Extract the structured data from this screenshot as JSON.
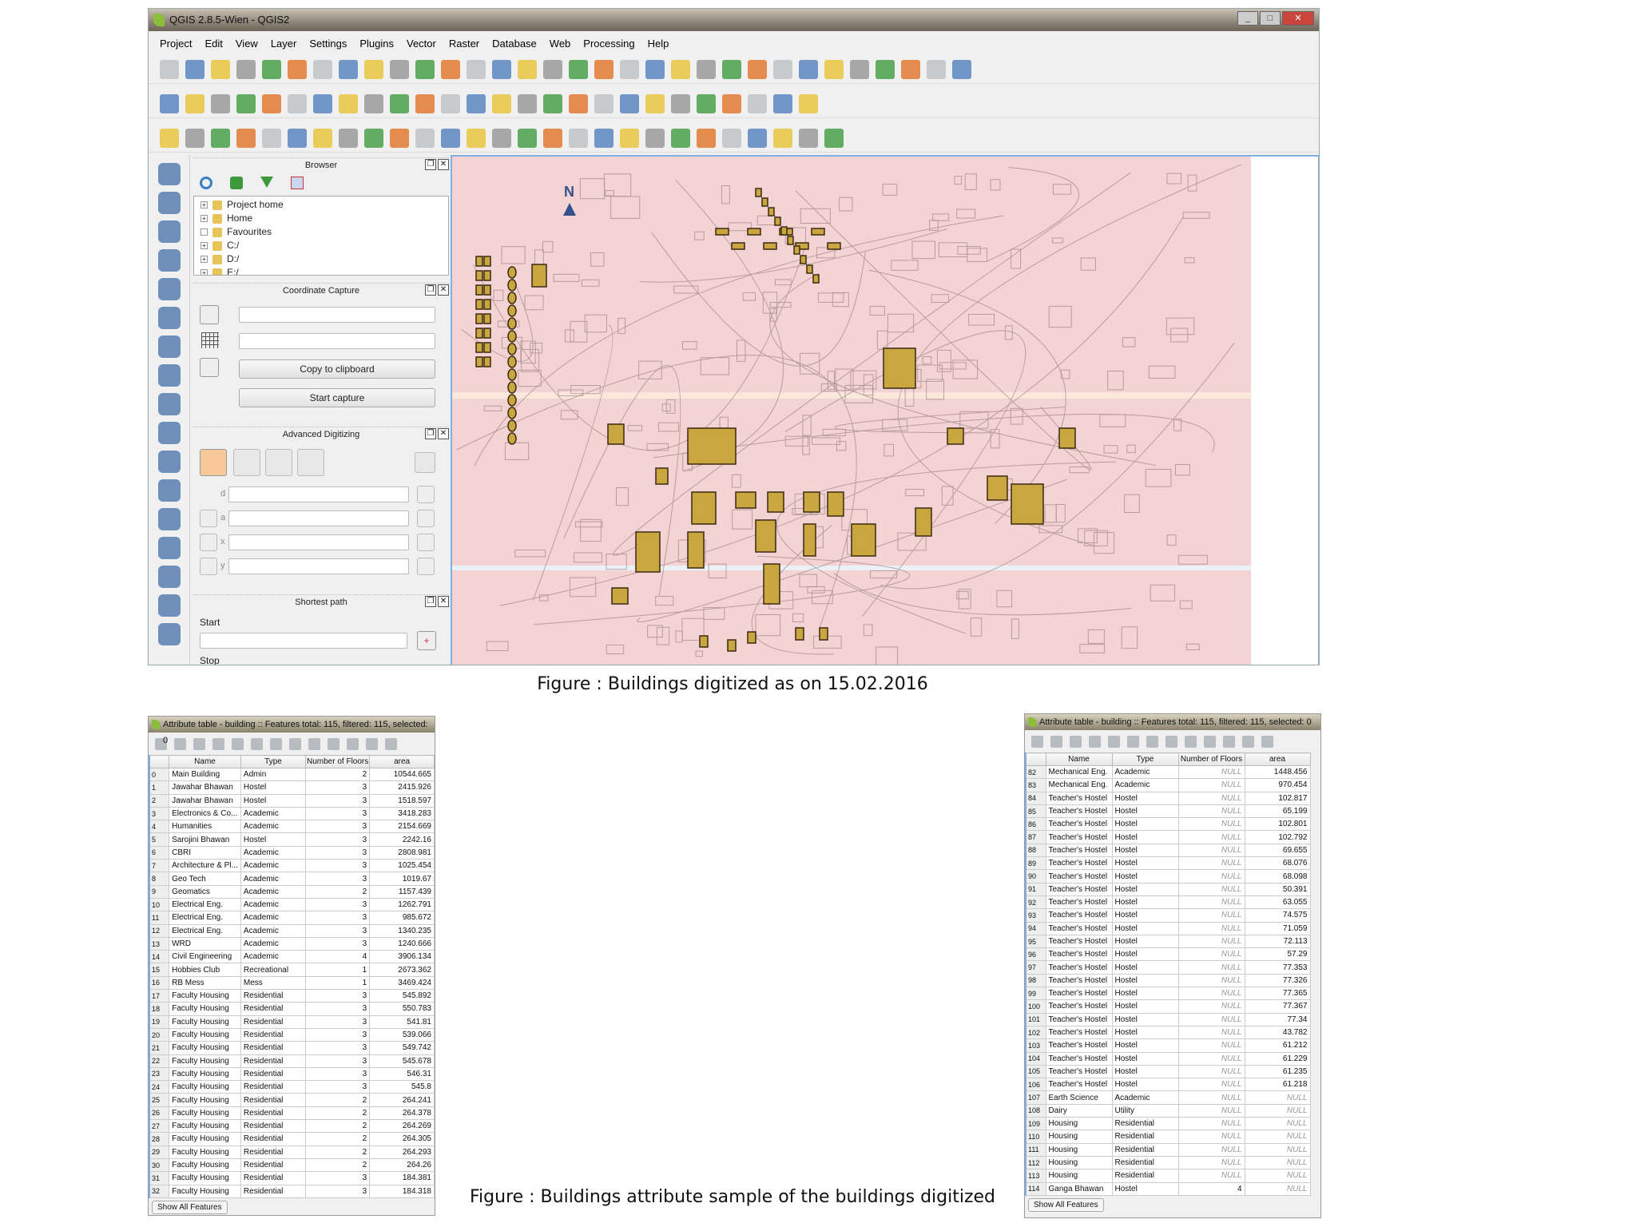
{
  "window": {
    "title": "QGIS 2.8.5-Wien - QGIS2",
    "controls": [
      "_",
      "□",
      "✕"
    ]
  },
  "menu": [
    "Project",
    "Edit",
    "View",
    "Layer",
    "Settings",
    "Plugins",
    "Vector",
    "Raster",
    "Database",
    "Web",
    "Processing",
    "Help"
  ],
  "toolbars": {
    "row1": [
      "new-project-icon",
      "open-project-icon",
      "save-project-icon",
      "save-as-icon",
      "new-print-composer-icon",
      "composer-manager-icon",
      "touch-zoom-icon",
      "pan-icon",
      "pan-to-selection-icon",
      "zoom-in-icon",
      "zoom-out-icon",
      "zoom-native-icon",
      "zoom-full-icon",
      "zoom-selection-icon",
      "zoom-layer-icon",
      "zoom-last-icon",
      "zoom-next-icon",
      "refresh-icon",
      "identify-icon",
      "action-icon",
      "select-icon",
      "deselect-icon",
      "expression-select-icon",
      "attribute-table-icon",
      "field-calculator-icon",
      "measure-icon",
      "map-tips-icon",
      "bookmark-icon",
      "show-bookmarks-icon",
      "text-annotation-icon",
      "help-icon",
      "whats-this-icon"
    ],
    "row2": [
      "current-edits-icon",
      "toggle-editing-icon",
      "save-edits-icon",
      "add-feature-icon",
      "move-feature-icon",
      "node-tool-icon",
      "delete-selected-icon",
      "cut-icon",
      "copy-icon",
      "paste-icon",
      "label-icon",
      "pin-label-icon",
      "show-hide-label-icon",
      "move-label-icon",
      "rotate-label-icon",
      "change-label-icon",
      "abc-icon",
      "grass-icon",
      "grass-tools-icon",
      "georeferencer-icon",
      "gps-icon",
      "db-manager-icon",
      "spatial-query-icon",
      "sqlite-icon",
      "csv-icon",
      "python-icon"
    ],
    "row3": [
      "advanced-digitize-icon",
      "undo-icon",
      "redo-icon",
      "simplify-icon",
      "add-ring-icon",
      "add-part-icon",
      "fill-ring-icon",
      "delete-ring-icon",
      "delete-part-icon",
      "reshape-icon",
      "offset-curve-icon",
      "split-features-icon",
      "split-parts-icon",
      "merge-selected-icon",
      "merge-attributes-icon",
      "rotate-point-icon",
      "rotate-feature-icon",
      "heatmap-icon",
      "interpolation-icon",
      "raster-calc-icon",
      "contour-icon",
      "terrain-icon",
      "grid-icon",
      "topology-icon",
      "statistics-icon",
      "summary-icon",
      "plugins-icon"
    ]
  },
  "left_toolbar": [
    "add-vector-layer-icon",
    "add-raster-layer-icon",
    "add-postgis-layer-icon",
    "add-spatialite-layer-icon",
    "add-mssql-layer-icon",
    "add-oracle-layer-icon",
    "add-sqlanywhere-layer-icon",
    "add-wms-layer-icon",
    "add-wcs-layer-icon",
    "add-wfs-layer-icon",
    "add-delimited-text-icon",
    "new-shapefile-icon",
    "create-layer-icon",
    "capture-point-icon",
    "shortest-path-icon",
    "offset-icon",
    "georef-icon"
  ],
  "browser": {
    "title": "Browser",
    "items": [
      "Project home",
      "Home",
      "Favourites",
      "C:/",
      "D:/",
      "E:/"
    ]
  },
  "coordinate_capture": {
    "title": "Coordinate Capture",
    "copy": "Copy to clipboard",
    "start": "Start capture"
  },
  "advanced_digitizing": {
    "title": "Advanced Digitizing",
    "fields": [
      "d",
      "a",
      "x",
      "y"
    ]
  },
  "shortest_path": {
    "title": "Shortest path",
    "start": "Start",
    "stop": "Stop"
  },
  "map": {
    "north_label": "N"
  },
  "captions": {
    "map": "Figure : Buildings digitized as on 15.02.2016",
    "table": "Figure : Buildings attribute sample of the buildings digitized"
  },
  "attr_left": {
    "title": "Attribute table - building :: Features total: 115, filtered: 115, selected: 0",
    "headers": [
      "Name",
      "Type",
      "Number of Floors",
      "area"
    ],
    "footer": "Show All Features",
    "rows": [
      [
        "0",
        "Main Building",
        "Admin",
        "2",
        "10544.665"
      ],
      [
        "1",
        "Jawahar Bhawan",
        "Hostel",
        "3",
        "2415.926"
      ],
      [
        "2",
        "Jawahar Bhawan",
        "Hostel",
        "3",
        "1518.597"
      ],
      [
        "3",
        "Electronics & Co...",
        "Academic",
        "3",
        "3418.283"
      ],
      [
        "4",
        "Humanities",
        "Academic",
        "3",
        "2154.669"
      ],
      [
        "5",
        "Sarojini Bhawan",
        "Hostel",
        "3",
        "2242.16"
      ],
      [
        "6",
        "CBRI",
        "Academic",
        "3",
        "2808.981"
      ],
      [
        "7",
        "Architecture & Pl...",
        "Academic",
        "3",
        "1025.454"
      ],
      [
        "8",
        "Geo Tech",
        "Academic",
        "3",
        "1019.67"
      ],
      [
        "9",
        "Geomatics",
        "Academic",
        "2",
        "1157.439"
      ],
      [
        "10",
        "Electrical Eng.",
        "Academic",
        "3",
        "1262.791"
      ],
      [
        "11",
        "Electrical Eng.",
        "Academic",
        "3",
        "985.672"
      ],
      [
        "12",
        "Electrical Eng.",
        "Academic",
        "3",
        "1340.235"
      ],
      [
        "13",
        "WRD",
        "Academic",
        "3",
        "1240.666"
      ],
      [
        "14",
        "Civil Engineering",
        "Academic",
        "4",
        "3906.134"
      ],
      [
        "15",
        "Hobbies Club",
        "Recreational",
        "1",
        "2673.362"
      ],
      [
        "16",
        "RB Mess",
        "Mess",
        "1",
        "3469.424"
      ],
      [
        "17",
        "Faculty Housing",
        "Residential",
        "3",
        "545.892"
      ],
      [
        "18",
        "Faculty Housing",
        "Residential",
        "3",
        "550.783"
      ],
      [
        "19",
        "Faculty Housing",
        "Residential",
        "3",
        "541.81"
      ],
      [
        "20",
        "Faculty Housing",
        "Residential",
        "3",
        "539.066"
      ],
      [
        "21",
        "Faculty Housing",
        "Residential",
        "3",
        "549.742"
      ],
      [
        "22",
        "Faculty Housing",
        "Residential",
        "3",
        "545.678"
      ],
      [
        "23",
        "Faculty Housing",
        "Residential",
        "3",
        "546.31"
      ],
      [
        "24",
        "Faculty Housing",
        "Residential",
        "3",
        "545.8"
      ],
      [
        "25",
        "Faculty Housing",
        "Residential",
        "2",
        "264.241"
      ],
      [
        "26",
        "Faculty Housing",
        "Residential",
        "2",
        "264.378"
      ],
      [
        "27",
        "Faculty Housing",
        "Residential",
        "2",
        "264.269"
      ],
      [
        "28",
        "Faculty Housing",
        "Residential",
        "2",
        "264.305"
      ],
      [
        "29",
        "Faculty Housing",
        "Residential",
        "2",
        "264.293"
      ],
      [
        "30",
        "Faculty Housing",
        "Residential",
        "2",
        "264.26"
      ],
      [
        "31",
        "Faculty Housing",
        "Residential",
        "3",
        "184.381"
      ],
      [
        "32",
        "Faculty Housing",
        "Residential",
        "3",
        "184.318"
      ]
    ]
  },
  "attr_right": {
    "title": "Attribute table - building :: Features total: 115, filtered: 115, selected: 0",
    "headers": [
      "Name",
      "Type",
      "Number of Floors",
      "area"
    ],
    "footer": "Show All Features",
    "rows": [
      [
        "82",
        "Mechanical Eng.",
        "Academic",
        "NULL",
        "1448.456"
      ],
      [
        "83",
        "Mechanical Eng.",
        "Academic",
        "NULL",
        "970.454"
      ],
      [
        "84",
        "Teacher's Hostel",
        "Hostel",
        "NULL",
        "102.817"
      ],
      [
        "85",
        "Teacher's Hostel",
        "Hostel",
        "NULL",
        "65.199"
      ],
      [
        "86",
        "Teacher's Hostel",
        "Hostel",
        "NULL",
        "102.801"
      ],
      [
        "87",
        "Teacher's Hostel",
        "Hostel",
        "NULL",
        "102.792"
      ],
      [
        "88",
        "Teacher's Hostel",
        "Hostel",
        "NULL",
        "69.655"
      ],
      [
        "89",
        "Teacher's Hostel",
        "Hostel",
        "NULL",
        "68.076"
      ],
      [
        "90",
        "Teacher's Hostel",
        "Hostel",
        "NULL",
        "68.098"
      ],
      [
        "91",
        "Teacher's Hostel",
        "Hostel",
        "NULL",
        "50.391"
      ],
      [
        "92",
        "Teacher's Hostel",
        "Hostel",
        "NULL",
        "63.055"
      ],
      [
        "93",
        "Teacher's Hostel",
        "Hostel",
        "NULL",
        "74.575"
      ],
      [
        "94",
        "Teacher's Hostel",
        "Hostel",
        "NULL",
        "71.059"
      ],
      [
        "95",
        "Teacher's Hostel",
        "Hostel",
        "NULL",
        "72.113"
      ],
      [
        "96",
        "Teacher's Hostel",
        "Hostel",
        "NULL",
        "57.29"
      ],
      [
        "97",
        "Teacher's Hostel",
        "Hostel",
        "NULL",
        "77.353"
      ],
      [
        "98",
        "Teacher's Hostel",
        "Hostel",
        "NULL",
        "77.326"
      ],
      [
        "99",
        "Teacher's Hostel",
        "Hostel",
        "NULL",
        "77.365"
      ],
      [
        "100",
        "Teacher's Hostel",
        "Hostel",
        "NULL",
        "77.367"
      ],
      [
        "101",
        "Teacher's Hostel",
        "Hostel",
        "NULL",
        "77.34"
      ],
      [
        "102",
        "Teacher's Hostel",
        "Hostel",
        "NULL",
        "43.782"
      ],
      [
        "103",
        "Teacher's Hostel",
        "Hostel",
        "NULL",
        "61.212"
      ],
      [
        "104",
        "Teacher's Hostel",
        "Hostel",
        "NULL",
        "61.229"
      ],
      [
        "105",
        "Teacher's Hostel",
        "Hostel",
        "NULL",
        "61.235"
      ],
      [
        "106",
        "Teacher's Hostel",
        "Hostel",
        "NULL",
        "61.218"
      ],
      [
        "107",
        "Earth Science",
        "Academic",
        "NULL",
        "NULL"
      ],
      [
        "108",
        "Dairy",
        "Utility",
        "NULL",
        "NULL"
      ],
      [
        "109",
        "Housing",
        "Residential",
        "NULL",
        "NULL"
      ],
      [
        "110",
        "Housing",
        "Residential",
        "NULL",
        "NULL"
      ],
      [
        "111",
        "Housing",
        "Residential",
        "NULL",
        "NULL"
      ],
      [
        "112",
        "Housing",
        "Residential",
        "NULL",
        "NULL"
      ],
      [
        "113",
        "Housing",
        "Residential",
        "NULL",
        "NULL"
      ],
      [
        "114",
        "Ganga Bhawan",
        "Hostel",
        "4",
        "NULL"
      ]
    ]
  },
  "colors": {
    "map_bg": "#f3d3d3",
    "building_fill": "#c9a640",
    "building_stroke": "#3a2a10",
    "selection_border": "#7fb0e0"
  }
}
